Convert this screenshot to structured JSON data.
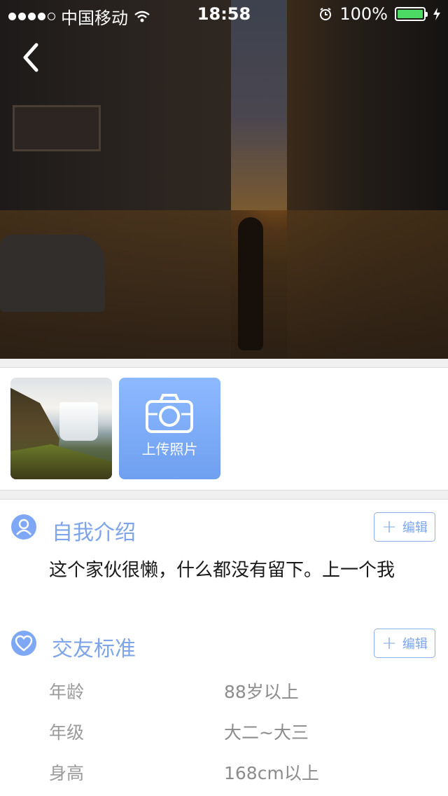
{
  "status_bar": {
    "carrier": "中国移动",
    "time": "18:58",
    "battery": "100%"
  },
  "hero": {
    "back_icon": "chevron-left-icon"
  },
  "photos": {
    "upload_label": "上传照片"
  },
  "intro": {
    "title": "自我介绍",
    "edit_label": "编辑",
    "text": "这个家伙很懒，什么都没有留下。上一个我"
  },
  "criteria": {
    "title": "交友标准",
    "edit_label": "编辑",
    "rows": [
      {
        "label": "年龄",
        "value": "88岁以上"
      },
      {
        "label": "年级",
        "value": "大二~大三"
      },
      {
        "label": "身高",
        "value": "168cm以上"
      }
    ]
  },
  "colors": {
    "accent": "#7ea4ea",
    "upload_bg": "#7ea8f5",
    "battery": "#4cd964"
  }
}
